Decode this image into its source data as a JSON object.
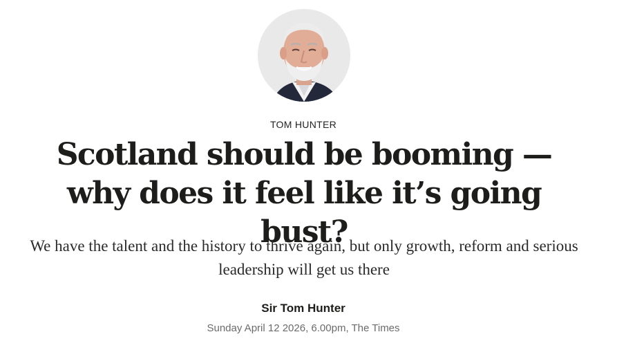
{
  "article": {
    "author_kicker": "TOM HUNTER",
    "headline": "Scotland should be booming — why does it feel like it’s going bust?",
    "standfirst": "We have the talent and the history to thrive again, but only growth, reform and serious leadership will get us there",
    "byline": "Sir Tom Hunter",
    "dateline": "Sunday April 12 2026, 6.00pm, The Times"
  }
}
